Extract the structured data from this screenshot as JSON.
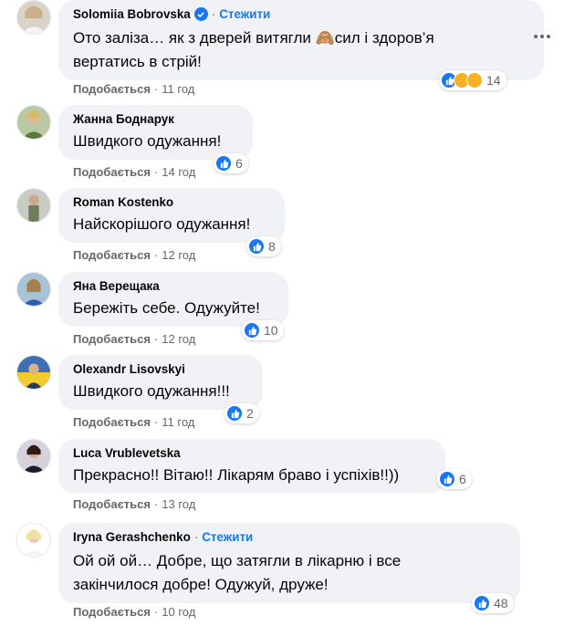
{
  "comments": [
    {
      "author": "Solomiia Bobrovska",
      "verified": true,
      "follow_label": "Стежити",
      "line1": "Ото заліза… як з дверей витягли 🙈сил і здоров’я",
      "line2": "вертатись в стрій!",
      "reaction_count": "14",
      "like_label": "Подобається",
      "time": "11 год"
    },
    {
      "author": "Жанна Боднарук",
      "line1": "Швидкого одужання!",
      "reaction_count": "6",
      "like_label": "Подобається",
      "time": "14 год"
    },
    {
      "author": "Roman Kostenko",
      "line1": "Найскорішого одужання!",
      "reaction_count": "8",
      "like_label": "Подобається",
      "time": "12 год"
    },
    {
      "author": "Яна Верещака",
      "line1": "Бережіть себе. Одужуйте!",
      "reaction_count": "10",
      "like_label": "Подобається",
      "time": "12 год"
    },
    {
      "author": "Olexandr Lisovskyi",
      "line1": "Швидкого одужання!!!",
      "reaction_count": "2",
      "like_label": "Подобається",
      "time": "11 год"
    },
    {
      "author": "Luca Vrublevetska",
      "line1": "Прекрасно!! Вітаю!! Лікарям браво і успіхів!!))",
      "reaction_count": "6",
      "like_label": "Подобається",
      "time": "13 год"
    },
    {
      "author": "Iryna Gerashchenko",
      "follow_label": "Стежити",
      "line1": "Ой ой ой… Добре, що затягли в лікарню і все",
      "line2": "закінчилося добре! Одужуй, друже!",
      "reaction_count": "48",
      "like_label": "Подобається",
      "time": "10 год"
    }
  ],
  "separator": "·",
  "colors": {
    "bubble": "#f0f2f5",
    "accent": "#1877f2",
    "meta": "#65676b"
  }
}
